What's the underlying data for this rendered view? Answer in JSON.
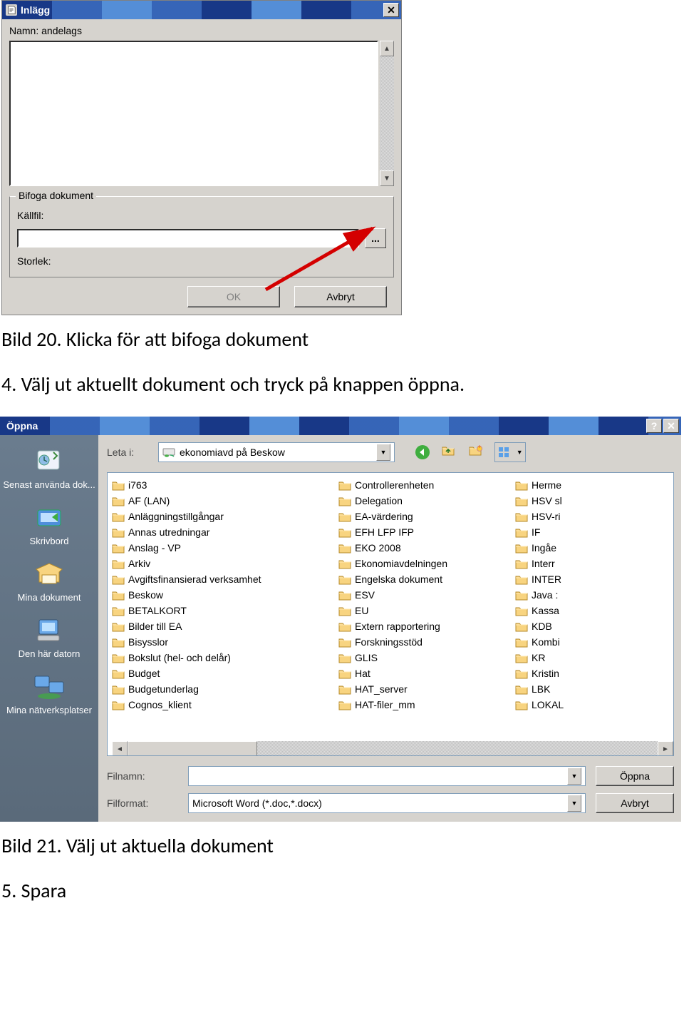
{
  "inlagg": {
    "title": "Inlägg",
    "namn_label": "Namn:",
    "namn_value": "andelags",
    "fieldset_legend": "Bifoga dokument",
    "kallfil_label": "Källfil:",
    "browse_label": "...",
    "storlek_label": "Storlek:",
    "ok_label": "OK",
    "avbryt_label": "Avbryt"
  },
  "caption1": "Bild 20. Klicka för att bifoga dokument",
  "step4": "4. Välj ut aktuellt dokument och tryck på knappen öppna.",
  "oppna": {
    "title": "Öppna",
    "leta_label": "Leta i:",
    "location": "ekonomiavd på Beskow",
    "places": [
      "Senast använda dok...",
      "Skrivbord",
      "Mina dokument",
      "Den här datorn",
      "Mina nätverksplatser"
    ],
    "folders_col1": [
      "i763",
      "AF (LAN)",
      "Anläggningstillgångar",
      "Annas utredningar",
      "Anslag - VP",
      "Arkiv",
      "Avgiftsfinansierad verksamhet",
      "Beskow",
      "BETALKORT",
      "Bilder till EA",
      "Bisysslor",
      "Bokslut (hel- och delår)",
      "Budget",
      "Budgetunderlag",
      "Cognos_klient"
    ],
    "folders_col2": [
      "Controllerenheten",
      "Delegation",
      "EA-värdering",
      "EFH LFP IFP",
      "EKO 2008",
      "Ekonomiavdelningen",
      "Engelska dokument",
      "ESV",
      "EU",
      "Extern rapportering",
      "Forskningsstöd",
      "GLIS",
      "Hat",
      "HAT_server",
      "HAT-filer_mm"
    ],
    "folders_col3": [
      "Herme",
      "HSV sl",
      "HSV-ri",
      "IF",
      "Ingåe",
      "Interr",
      "INTER",
      "Java :",
      "Kassa",
      "KDB",
      "Kombi",
      "KR",
      "Kristin",
      "LBK",
      "LOKAL"
    ],
    "filnamn_label": "Filnamn:",
    "filformat_label": "Filformat:",
    "filformat_value": "Microsoft Word (*.doc,*.docx)",
    "open_btn": "Öppna",
    "cancel_btn": "Avbryt"
  },
  "caption2": "Bild 21. Välj ut aktuella dokument",
  "step5": "5. Spara"
}
